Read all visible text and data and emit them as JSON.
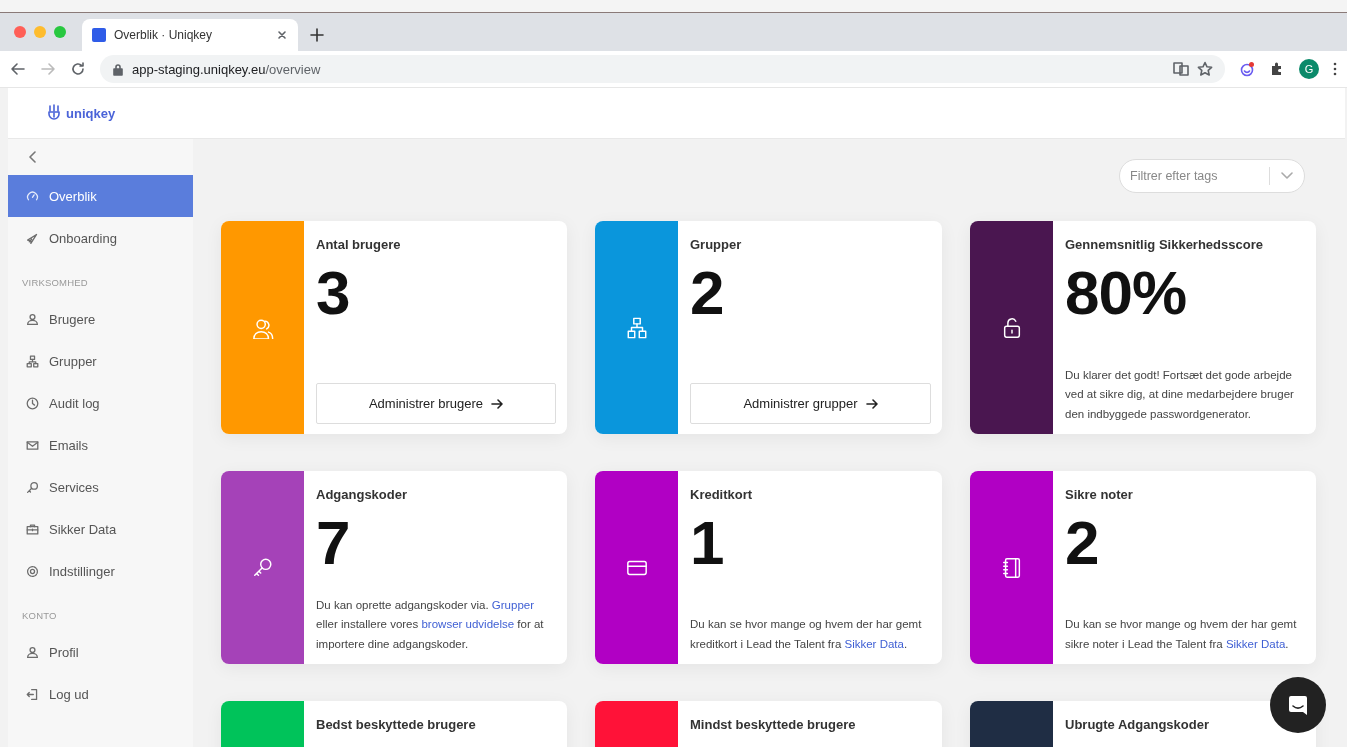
{
  "browser": {
    "tab_title": "Overblik · Uniqkey",
    "url_host": "app-staging.uniqkey.eu",
    "url_path": "/overview",
    "profile_letter": "G"
  },
  "header": {
    "logo_text": "uniqkey"
  },
  "sidebar": {
    "items": [
      {
        "kind": "item",
        "label": "Overblik",
        "selected": true
      },
      {
        "kind": "item",
        "label": "Onboarding",
        "selected": false
      },
      {
        "kind": "heading",
        "label": "VIRKSOMHED"
      },
      {
        "kind": "item",
        "label": "Brugere",
        "selected": false
      },
      {
        "kind": "item",
        "label": "Grupper",
        "selected": false
      },
      {
        "kind": "item",
        "label": "Audit log",
        "selected": false
      },
      {
        "kind": "item",
        "label": "Emails",
        "selected": false
      },
      {
        "kind": "item",
        "label": "Services",
        "selected": false
      },
      {
        "kind": "item",
        "label": "Sikker Data",
        "selected": false
      },
      {
        "kind": "item",
        "label": "Indstillinger",
        "selected": false
      },
      {
        "kind": "heading",
        "label": "KONTO"
      },
      {
        "kind": "item",
        "label": "Profil",
        "selected": false
      },
      {
        "kind": "item",
        "label": "Log ud",
        "selected": false
      }
    ]
  },
  "filter": {
    "placeholder": "Filtrer efter tags"
  },
  "cards": [
    {
      "kind": "action",
      "title": "Antal brugere",
      "value": "3",
      "color": "#ff9800",
      "button": "Administrer brugere"
    },
    {
      "kind": "action",
      "title": "Grupper",
      "value": "2",
      "color": "#0a96dc",
      "button": "Administrer grupper"
    },
    {
      "kind": "text",
      "title": "Gennemsnitlig Sikkerhedsscore",
      "value": "80%",
      "color": "#4a1650",
      "description": [
        {
          "kind": "plain",
          "text": "Du klarer det godt! Fortsæt det gode arbejde ved at sikre dig, at dine medarbejdere bruger den indbyggede passwordgenerator."
        }
      ]
    },
    {
      "kind": "text",
      "title": "Adgangskoder",
      "value": "7",
      "color": "#a542b8",
      "description": [
        {
          "kind": "plain",
          "text": "Du kan oprette adgangskoder via. "
        },
        {
          "kind": "link",
          "text": "Grupper"
        },
        {
          "kind": "plain",
          "text": " eller installere vores "
        },
        {
          "kind": "link",
          "text": "browser udvidelse"
        },
        {
          "kind": "plain",
          "text": " for at importere dine adgangskoder."
        }
      ]
    },
    {
      "kind": "text",
      "title": "Kreditkort",
      "value": "1",
      "color": "#b100c4",
      "description": [
        {
          "kind": "plain",
          "text": "Du kan se hvor mange og hvem der har gemt kreditkort i Lead the Talent fra "
        },
        {
          "kind": "link",
          "text": "Sikker Data"
        },
        {
          "kind": "plain",
          "text": "."
        }
      ]
    },
    {
      "kind": "text",
      "title": "Sikre noter",
      "value": "2",
      "color": "#b100c4",
      "description": [
        {
          "kind": "plain",
          "text": "Du kan se hvor mange og hvem der har gemt sikre noter i Lead the Talent fra "
        },
        {
          "kind": "link",
          "text": "Sikker Data"
        },
        {
          "kind": "plain",
          "text": "."
        }
      ]
    },
    {
      "kind": "partial",
      "title": "Bedst beskyttede brugere",
      "color": "#00c35a"
    },
    {
      "kind": "partial",
      "title": "Mindst beskyttede brugere",
      "color": "#ff1238"
    },
    {
      "kind": "partial",
      "title": "Ubrugte Adgangskoder",
      "color": "#1f2d44"
    }
  ]
}
